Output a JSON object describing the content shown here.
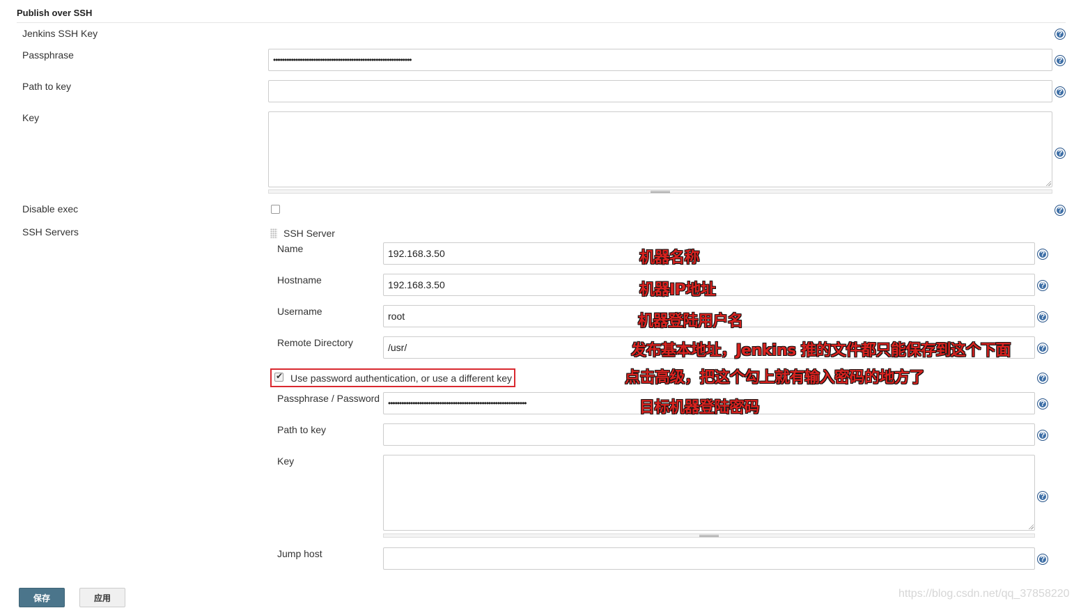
{
  "section": {
    "title": "Publish over SSH"
  },
  "global": {
    "jenkins_ssh_key_label": "Jenkins SSH Key",
    "passphrase_label": "Passphrase",
    "passphrase_value": "••••••••••••••••••••••••••••••••••••••••••••••••••••••••••••••",
    "path_to_key_label": "Path to key",
    "path_to_key_value": "",
    "key_label": "Key",
    "key_value": "",
    "disable_exec_label": "Disable exec",
    "ssh_servers_label": "SSH Servers"
  },
  "server": {
    "header": "SSH Server",
    "name_label": "Name",
    "name_value": "192.168.3.50",
    "hostname_label": "Hostname",
    "hostname_value": "192.168.3.50",
    "username_label": "Username",
    "username_value": "root",
    "remote_dir_label": "Remote Directory",
    "remote_dir_value": "/usr/",
    "use_password_label": "Use password authentication, or use a different key",
    "password_label": "Passphrase / Password",
    "password_value": "••••••••••••••••••••••••••••••••••••••••••••••••••••••••••••••",
    "path_to_key_label": "Path to key",
    "path_to_key_value": "",
    "key_label": "Key",
    "key_value": "",
    "jump_host_label": "Jump host",
    "jump_host_value": ""
  },
  "annotations": {
    "name": "机器名称",
    "hostname": "机器IP地址",
    "username": "机器登陆用户名",
    "remote_dir": "发布基本地址，Jenkins 推的文件都只能保存到这个下面",
    "use_password": "点击高级，把这个勾上就有输入密码的地方了",
    "password": "目标机器登陆密码"
  },
  "buttons": {
    "save": "保存",
    "apply": "应用"
  },
  "help_glyph": "?",
  "watermark": "https://blog.csdn.net/qq_37858220",
  "colors": {
    "annotation": "#d8221f",
    "highlight": "#d9282f",
    "primary_button": "#4b758b",
    "help_icon": "#3c6ea6"
  }
}
